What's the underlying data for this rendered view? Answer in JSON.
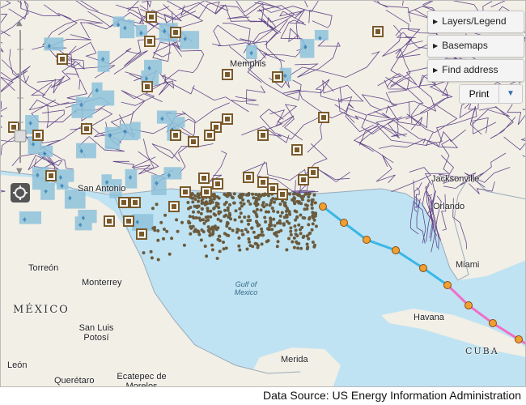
{
  "map": {
    "labels": [
      {
        "text": "Memphis",
        "kind": "city"
      },
      {
        "text": "San Antonio",
        "kind": "city"
      },
      {
        "text": "Jacksonville",
        "kind": "city"
      },
      {
        "text": "Orlando",
        "kind": "city"
      },
      {
        "text": "Miami",
        "kind": "city"
      },
      {
        "text": "Torreón",
        "kind": "city"
      },
      {
        "text": "Monterrey",
        "kind": "city"
      },
      {
        "text": "MÉXICO",
        "kind": "country"
      },
      {
        "text": "San Luis Potosí",
        "kind": "city"
      },
      {
        "text": "León",
        "kind": "city"
      },
      {
        "text": "Querétaro",
        "kind": "city"
      },
      {
        "text": "Ecatepec de Morelos",
        "kind": "city"
      },
      {
        "text": "Havana",
        "kind": "city"
      },
      {
        "text": "CUBA",
        "kind": "country"
      },
      {
        "text": "Merida",
        "kind": "city"
      },
      {
        "text": "Gulf of Mexico",
        "kind": "sea"
      }
    ],
    "colors": {
      "water": "#bfe3f2",
      "land": "#f2efe6",
      "pipelines": "#4a2a7a",
      "fields": "#8fc3dc",
      "platforms": "#6b5a3c",
      "storm_track_a": "#3bb7e6",
      "storm_track_b": "#f06ec8",
      "storm_points": "#f0a030"
    },
    "icons": {
      "gas_field": "flame-drop-icon",
      "facility": "refinery-square-icon",
      "storm_point": "orange-circle-icon"
    }
  },
  "controls": {
    "layers_label": "Layers/Legend",
    "basemaps_label": "Basemaps",
    "find_label": "Find address",
    "print_label": "Print"
  },
  "footer": {
    "source": "Data Source: US Energy Information Administration"
  }
}
